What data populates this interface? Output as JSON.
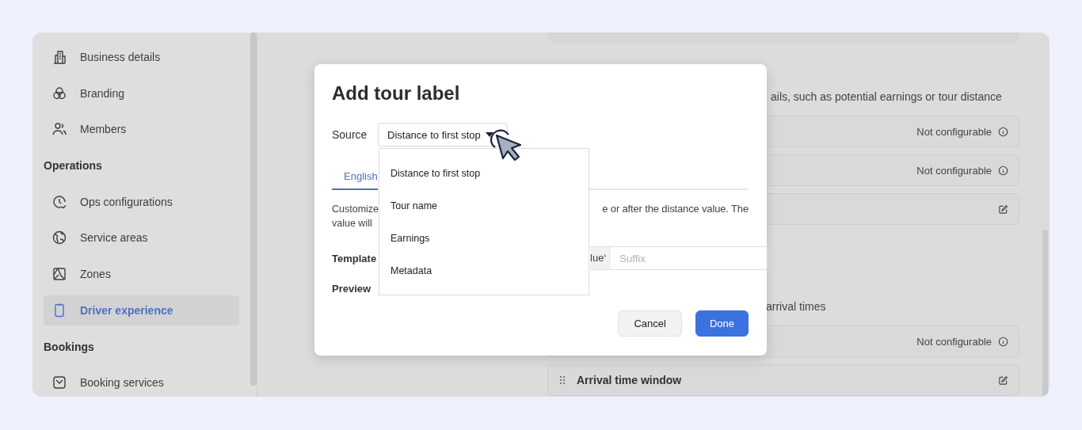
{
  "sidebar": {
    "items": [
      {
        "kind": "item",
        "label": "Business details",
        "selected": false
      },
      {
        "kind": "item",
        "label": "Branding",
        "selected": false
      },
      {
        "kind": "item",
        "label": "Members",
        "selected": false
      },
      {
        "kind": "section",
        "label": "Operations"
      },
      {
        "kind": "item",
        "label": "Ops configurations",
        "selected": false
      },
      {
        "kind": "item",
        "label": "Service areas",
        "selected": false
      },
      {
        "kind": "item",
        "label": "Zones",
        "selected": false
      },
      {
        "kind": "item",
        "label": "Driver experience",
        "selected": true
      },
      {
        "kind": "section",
        "label": "Bookings"
      },
      {
        "kind": "item",
        "label": "Booking services",
        "selected": false
      }
    ]
  },
  "main": {
    "description": "ails, such as potential earnings or tour distance",
    "rows": [
      {
        "kind": "locked",
        "status": "Not configurable"
      },
      {
        "kind": "locked",
        "status": "Not configurable"
      },
      {
        "kind": "editable"
      }
    ],
    "section_text": "arrival times",
    "rows_2": [
      {
        "kind": "locked",
        "status": "Not configurable"
      },
      {
        "kind": "editable",
        "label": "Arrival time window"
      }
    ]
  },
  "modal": {
    "title": "Add tour label",
    "source": {
      "label": "Source",
      "value": "Distance to first stop"
    },
    "tabs": [
      {
        "label": "English",
        "selected": true
      }
    ],
    "description": {
      "left": [
        "Customize",
        "value will"
      ],
      "right": "e or after the distance value. The"
    },
    "template": {
      "label": "Template",
      "addon": "lue‘",
      "placeholder": "Suffix"
    },
    "preview": {
      "label": "Preview"
    },
    "buttons": [
      {
        "kind": "secondary",
        "label": "Cancel"
      },
      {
        "kind": "primary",
        "label": "Done"
      }
    ],
    "dropdown": {
      "options": [
        "Distance to first stop",
        "Tour name",
        "Earnings",
        "Metadata"
      ]
    }
  }
}
